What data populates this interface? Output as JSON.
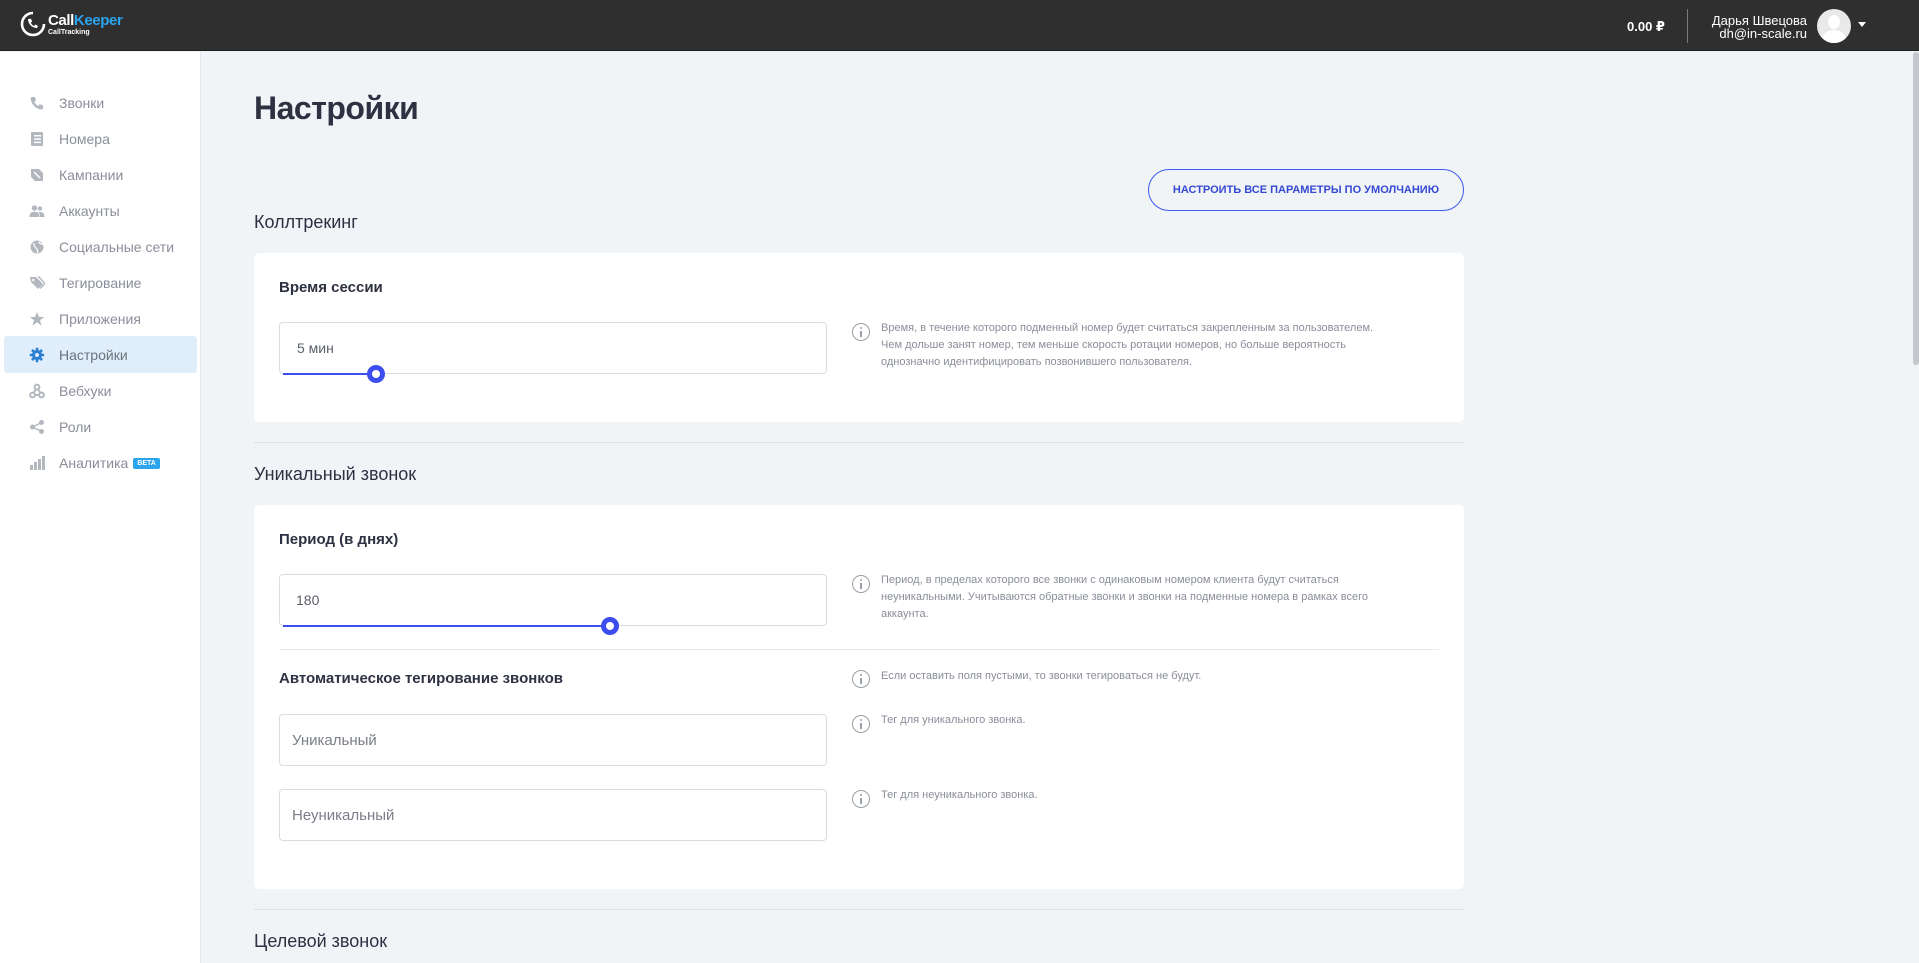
{
  "topbar": {
    "logo": {
      "name_call": "Call",
      "name_keeper": "Keeper",
      "sub": "CallTracking"
    },
    "balance": "0.00 ₽",
    "user": {
      "name": "Дарья Швецова",
      "email": "dh@in-scale.ru"
    }
  },
  "sidebar": {
    "items": [
      {
        "label": "Звонки",
        "icon": "phone-icon",
        "active": false
      },
      {
        "label": "Номера",
        "icon": "list-icon",
        "active": false
      },
      {
        "label": "Кампании",
        "icon": "megaphone-icon",
        "active": false
      },
      {
        "label": "Аккаунты",
        "icon": "users-icon",
        "active": false
      },
      {
        "label": "Социальные сети",
        "icon": "globe-icon",
        "active": false
      },
      {
        "label": "Тегирование",
        "icon": "tags-icon",
        "active": false
      },
      {
        "label": "Приложения",
        "icon": "star-icon",
        "active": false
      },
      {
        "label": "Настройки",
        "icon": "gear-icon",
        "active": true
      },
      {
        "label": "Вебхуки",
        "icon": "webhook-icon",
        "active": false
      },
      {
        "label": "Роли",
        "icon": "share-icon",
        "active": false
      },
      {
        "label": "Аналитика",
        "icon": "bar-chart-icon",
        "active": false,
        "badge": "BETA"
      }
    ]
  },
  "main": {
    "title": "Настройки",
    "reset_button": "НАСТРОИТЬ ВСЕ ПАРАМЕТРЫ ПО УМОЛЧАНИЮ",
    "sections": {
      "calltracking": {
        "title": "Коллтрекинг",
        "session_label": "Время сессии",
        "session_value": "5 мин",
        "session_level": 0.17,
        "session_hint": "Время, в течение которого подменный номер будет считаться закрепленным за пользователем. Чем дольше занят номер, тем меньше скорость ротации номеров, но больше вероятность однозначно идентифицировать позвонившего пользователя."
      },
      "unique_call": {
        "title": "Уникальный звонок",
        "period_label": "Период (в днях)",
        "period_value": "180",
        "period_level": 0.49,
        "period_hint": "Период, в пределах которого все звонки с одинаковым номером клиента будут считаться неуникальными. Учитываются обратные звонки и звонки на подменные номера в рамках всего аккаунта.",
        "autotag_label": "Автоматическое тегирование звонков",
        "autotag_hint": "Если оставить поля пустыми, то звонки тегироваться не будут.",
        "unique_placeholder": "Уникальный",
        "unique_hint": "Тег для уникального звонка.",
        "nonunique_placeholder": "Неуникальный",
        "nonunique_hint": "Тег для неуникального звонка."
      },
      "target_call": {
        "title": "Целевой звонок"
      }
    }
  },
  "colors": {
    "accent": "#3d4ef0",
    "brand_blue": "#2ba4f0",
    "topbar": "#2f2f2f",
    "background": "#f0f4f6"
  }
}
